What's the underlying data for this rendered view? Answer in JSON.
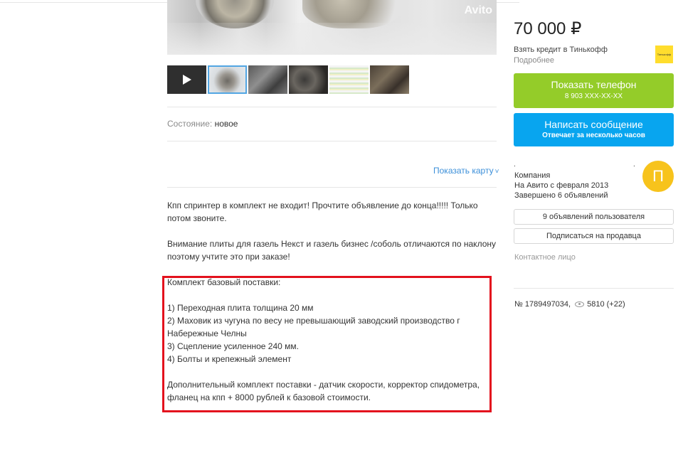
{
  "gallery": {
    "watermark": "Avito",
    "thumbnails": [
      "video",
      "flywheel",
      "cab",
      "engine",
      "spreadsheet",
      "gearbox"
    ]
  },
  "params": {
    "condition_key": "Состояние:",
    "condition_value": "новое"
  },
  "map": {
    "show_map_label": "Показать карту",
    "chevron": "˅"
  },
  "description": {
    "p1": "Кпп спринтер в комплект не входит! Прочтите объявление до конца!!!!! Только потом звоните.",
    "p2": "Внимание плиты для газель Некст и газель бизнес /соболь отличаются по наклону поэтому учтите это при заказе!",
    "kit_title": "Комплект базовый поставки:",
    "kit_items": [
      "1) Переходная плита толщина 20 мм",
      "2) Маховик из чугуна по весу не превышающий заводский производство г Набережные Челны",
      "3) Сцепление усиленное 240 мм.",
      "4) Болты и крепежный элемент"
    ],
    "extra": "Дополнительный комплект поставки - датчик скорости, корректор спидометра, фланец на кпп + 8000 рублей к базовой стоимости."
  },
  "sidebar": {
    "price": "70 000 ₽",
    "credit_text": "Взять кредит в Тинькофф",
    "credit_more": "Подробнее",
    "bank_logo_text": "Тинькофф",
    "phone_button": "Показать телефон",
    "phone_number": "8 903 XXX-XX-XX",
    "message_button": "Написать сообщение",
    "message_sub": "Отвечает за несколько часов",
    "seller_name_mark": ".",
    "seller_type": "Компания",
    "seller_since": "На Авито с февраля 2013",
    "seller_completed": "Завершено 6 объявлений",
    "avatar_letter": "П",
    "user_ads_button": "9 объявлений пользователя",
    "subscribe_button": "Подписаться на продавца",
    "contact_person": "Контактное лицо",
    "ad_number": "№ 1789497034,",
    "views": "5810 (+22)"
  },
  "colors": {
    "phone_button": "#94cc29",
    "message_button": "#08a5ef",
    "link": "#3b8fd9",
    "highlight_box": "#e3111d",
    "avatar": "#f7c31c",
    "bank_logo": "#ffdd2d"
  }
}
